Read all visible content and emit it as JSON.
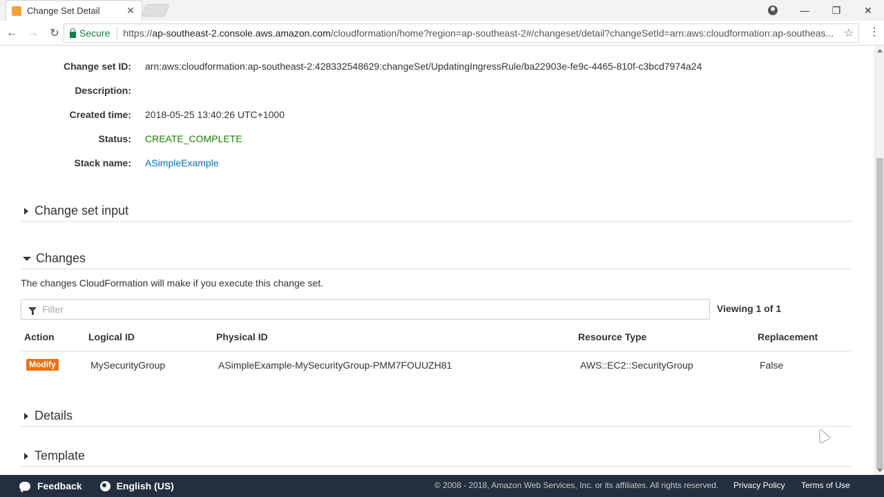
{
  "browser": {
    "tab_title": "Change Set Detail",
    "tab_close": "✕",
    "secure_label": "Secure",
    "url_scheme": "https://",
    "url_host": "ap-southeast-2.console.aws.amazon.com",
    "url_path": "/cloudformation/home?region=ap-southeast-2#/changeset/detail?changeSetId=arn:aws:cloudformation:ap-southeas..."
  },
  "details": {
    "change_set_id_label": "Change set ID:",
    "change_set_id": "arn:aws:cloudformation:ap-southeast-2:428332548629:changeSet/UpdatingIngressRule/ba22903e-fe9c-4465-810f-c3bcd7974a24",
    "description_label": "Description:",
    "description": "",
    "created_time_label": "Created time:",
    "created_time": "2018-05-25 13:40:26 UTC+1000",
    "status_label": "Status:",
    "status": "CREATE_COMPLETE",
    "status_color": "#1d8102",
    "stack_name_label": "Stack name:",
    "stack_name": "ASimpleExample"
  },
  "sections": {
    "change_set_input": "Change set input",
    "changes": "Changes",
    "details": "Details",
    "template": "Template"
  },
  "changes": {
    "description": "The changes CloudFormation will make if you execute this change set.",
    "filter_placeholder": "Filter",
    "viewing": "Viewing 1 of 1",
    "columns": {
      "action": "Action",
      "logical_id": "Logical ID",
      "physical_id": "Physical ID",
      "resource_type": "Resource Type",
      "replacement": "Replacement"
    },
    "rows": [
      {
        "action": "Modify",
        "logical_id": "MySecurityGroup",
        "physical_id": "ASimpleExample-MySecurityGroup-PMM7FOUUZH81",
        "resource_type": "AWS::EC2::SecurityGroup",
        "replacement": "False"
      }
    ],
    "badge_color": "#ec7211"
  },
  "footer": {
    "feedback": "Feedback",
    "language": "English (US)",
    "copyright": "© 2008 - 2018, Amazon Web Services, Inc. or its affiliates. All rights reserved.",
    "privacy": "Privacy Policy",
    "terms": "Terms of Use"
  }
}
